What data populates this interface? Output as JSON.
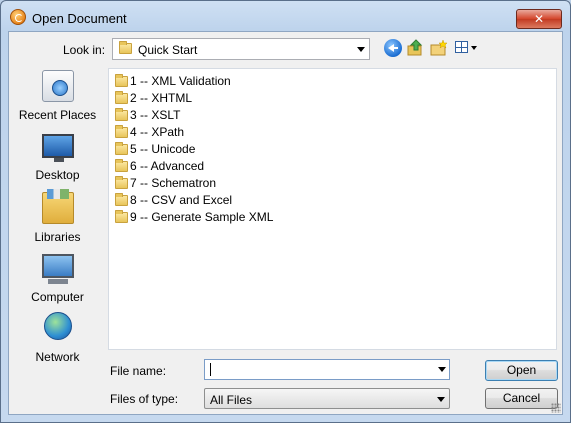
{
  "dialog": {
    "title": "Open Document",
    "close_label": "✕"
  },
  "lookin": {
    "label": "Look in:",
    "value": "Quick Start"
  },
  "places": [
    {
      "label": "Recent Places",
      "icon": "recent-places-icon"
    },
    {
      "label": "Desktop",
      "icon": "desktop-icon"
    },
    {
      "label": "Libraries",
      "icon": "libraries-icon"
    },
    {
      "label": "Computer",
      "icon": "computer-icon"
    },
    {
      "label": "Network",
      "icon": "network-icon"
    }
  ],
  "files": [
    "1 -- XML Validation",
    "2 -- XHTML",
    "3 -- XSLT",
    "4 -- XPath",
    "5 -- Unicode",
    "6 -- Advanced",
    "7 -- Schematron",
    "8 -- CSV and Excel",
    "9 -- Generate Sample XML"
  ],
  "filename": {
    "label": "File name:",
    "value": ""
  },
  "filetype": {
    "label": "Files of type:",
    "value": "All Files"
  },
  "buttons": {
    "open": "Open",
    "cancel": "Cancel"
  },
  "colors": {
    "title_bar": "#bdd3ec",
    "client_bg": "#f0f0f0",
    "close_button": "#c23b22"
  }
}
